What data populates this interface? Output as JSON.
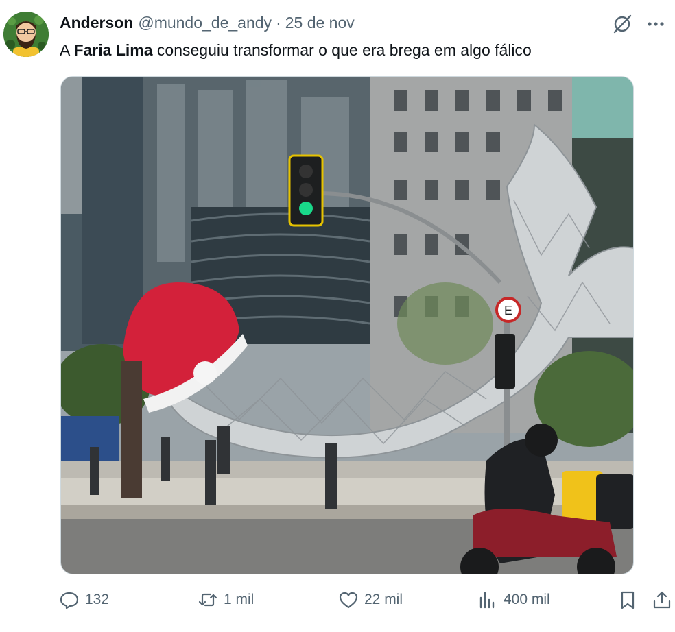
{
  "tweet": {
    "author": {
      "display_name": "Anderson",
      "handle": "@mundo_de_andy",
      "avatar_icon": "bearded-man-avatar"
    },
    "separator": "·",
    "date": "25 de nov",
    "text": {
      "part1": "A ",
      "bold": "Faria Lima",
      "part2": " conseguiu transformar o que era brega em algo fálico"
    },
    "media": {
      "type": "photo",
      "icon": "whale-sculpture-photo"
    },
    "header_actions": [
      {
        "icon": "grok-slash-icon"
      },
      {
        "icon": "more-icon"
      }
    ],
    "metrics": {
      "replies": "132",
      "reposts": "1 mil",
      "likes": "22 mil",
      "views": "400 mil"
    }
  },
  "colors": {
    "text_primary": "#0f1419",
    "text_secondary": "#536471",
    "border": "#cfd9de",
    "santa_hat_red": "#d3213a"
  }
}
